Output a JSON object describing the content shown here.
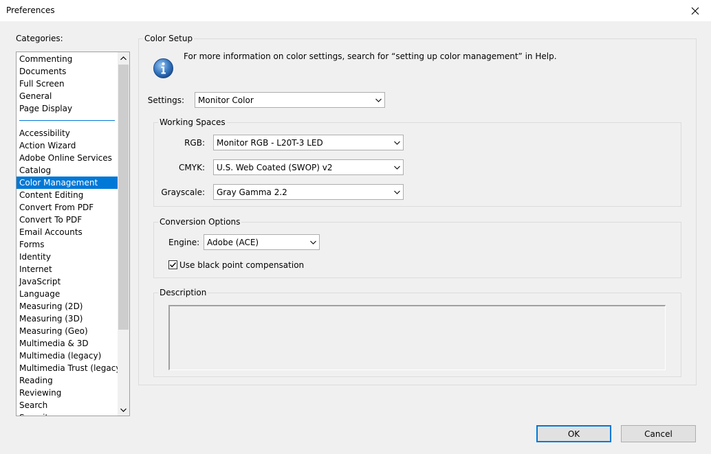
{
  "window": {
    "title": "Preferences"
  },
  "categories": {
    "label": "Categories:",
    "group1": [
      "Commenting",
      "Documents",
      "Full Screen",
      "General",
      "Page Display"
    ],
    "group2": [
      "Accessibility",
      "Action Wizard",
      "Adobe Online Services",
      "Catalog",
      "Color Management",
      "Content Editing",
      "Convert From PDF",
      "Convert To PDF",
      "Email Accounts",
      "Forms",
      "Identity",
      "Internet",
      "JavaScript",
      "Language",
      "Measuring (2D)",
      "Measuring (3D)",
      "Measuring (Geo)",
      "Multimedia & 3D",
      "Multimedia (legacy)",
      "Multimedia Trust (legacy)",
      "Reading",
      "Reviewing",
      "Search",
      "Security"
    ],
    "selected": "Color Management"
  },
  "color_setup": {
    "title": "Color Setup",
    "info_text": "For more information on color settings, search for “setting up color management” in Help.",
    "settings_label": "Settings:",
    "settings_value": "Monitor Color"
  },
  "working_spaces": {
    "title": "Working Spaces",
    "rgb_label": "RGB:",
    "rgb_value": "Monitor RGB - L20T-3 LED",
    "cmyk_label": "CMYK:",
    "cmyk_value": "U.S. Web Coated (SWOP) v2",
    "grayscale_label": "Grayscale:",
    "grayscale_value": "Gray Gamma 2.2"
  },
  "conversion": {
    "title": "Conversion Options",
    "engine_label": "Engine:",
    "engine_value": "Adobe (ACE)",
    "bpc_label": "Use black point compensation",
    "bpc_checked": true
  },
  "description": {
    "title": "Description"
  },
  "buttons": {
    "ok": "OK",
    "cancel": "Cancel"
  },
  "colors": {
    "selection": "#0078d7",
    "default_button_border": "#0078d7"
  }
}
